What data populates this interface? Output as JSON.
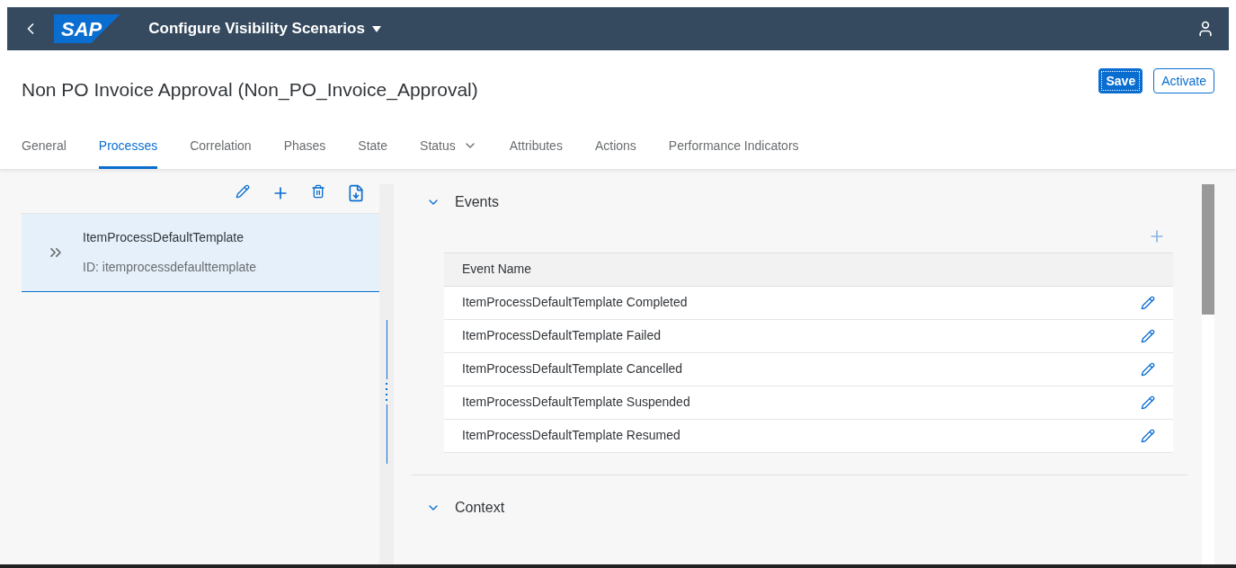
{
  "shell": {
    "logo": "SAP",
    "title": "Configure Visibility Scenarios"
  },
  "page": {
    "title": "Non PO Invoice Approval (Non_PO_Invoice_Approval)",
    "actions": [
      {
        "label": "Save",
        "kind": "primary"
      },
      {
        "label": "Activate",
        "kind": "secondary"
      }
    ]
  },
  "tabs": [
    {
      "label": "General",
      "selected": false,
      "dropdown": false
    },
    {
      "label": "Processes",
      "selected": true,
      "dropdown": false
    },
    {
      "label": "Correlation",
      "selected": false,
      "dropdown": false
    },
    {
      "label": "Phases",
      "selected": false,
      "dropdown": false
    },
    {
      "label": "State",
      "selected": false,
      "dropdown": false
    },
    {
      "label": "Status",
      "selected": false,
      "dropdown": true
    },
    {
      "label": "Attributes",
      "selected": false,
      "dropdown": false
    },
    {
      "label": "Actions",
      "selected": false,
      "dropdown": false
    },
    {
      "label": "Performance Indicators",
      "selected": false,
      "dropdown": false
    }
  ],
  "processes": [
    {
      "name": "ItemProcessDefaultTemplate",
      "id": "ID: itemprocessdefaulttemplate",
      "selected": true
    }
  ],
  "sections": [
    {
      "title": "Events",
      "expanded": true,
      "table": {
        "columns": [
          "Event Name"
        ],
        "rows": [
          "ItemProcessDefaultTemplate Completed",
          "ItemProcessDefaultTemplate Failed",
          "ItemProcessDefaultTemplate Cancelled",
          "ItemProcessDefaultTemplate Suspended",
          "ItemProcessDefaultTemplate Resumed"
        ]
      }
    },
    {
      "title": "Context",
      "expanded": true
    }
  ]
}
